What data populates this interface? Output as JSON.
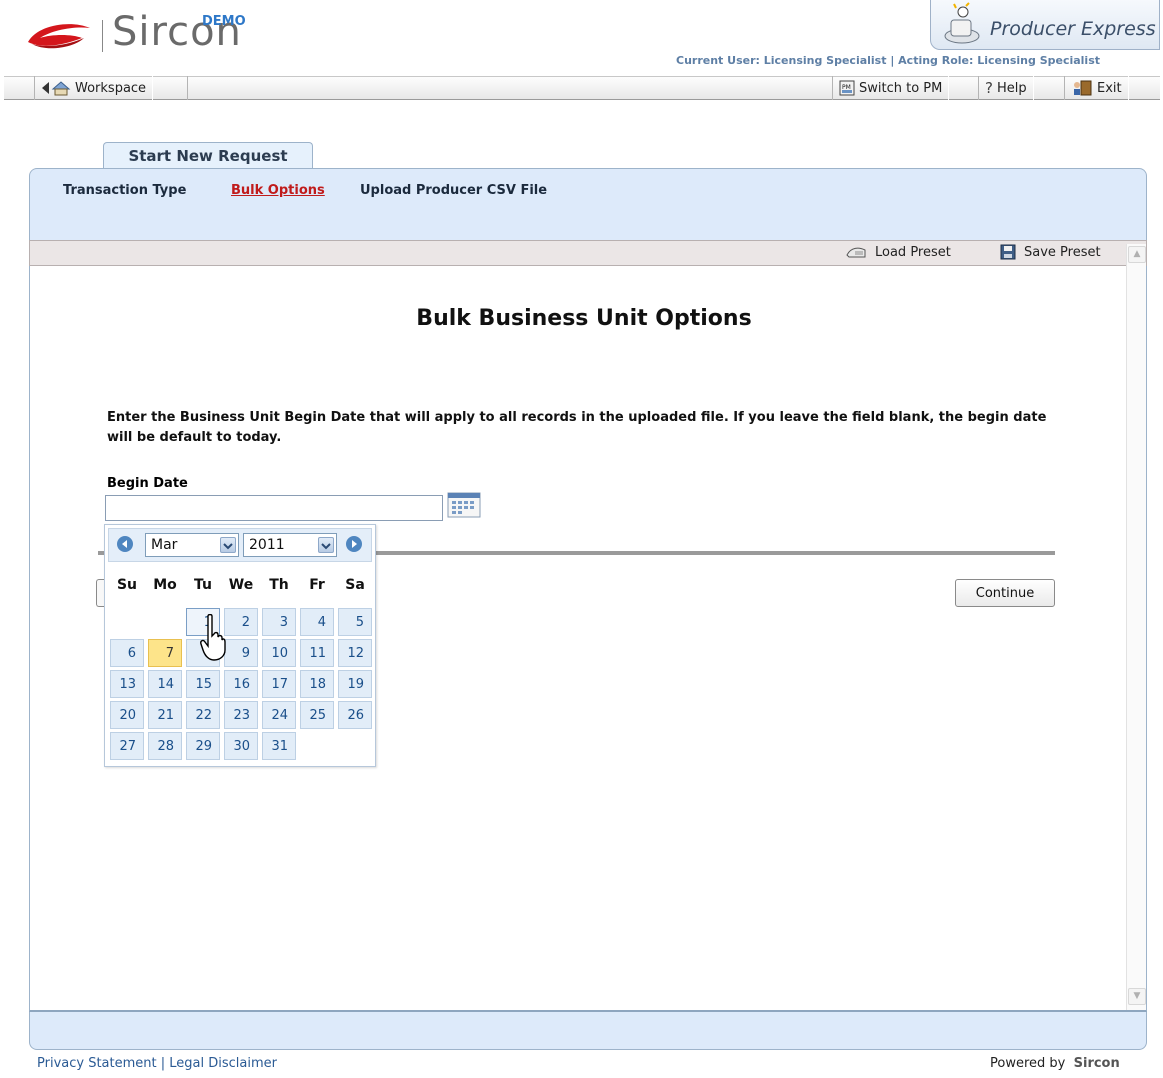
{
  "header": {
    "logo_text": "Sircon",
    "logo_badge": "DEMO",
    "product": "Producer Express",
    "user_label": "Current User: Licensing Specialist | Acting Role: Licensing Specialist"
  },
  "toolbar": {
    "workspace": "Workspace",
    "switch_pm": "Switch to PM",
    "help": "Help",
    "exit": "Exit"
  },
  "request_tab": "Start New Request",
  "steps": [
    {
      "label": "Transaction Type",
      "active": false
    },
    {
      "label": "Bulk Options",
      "active": true
    },
    {
      "label": "Upload Producer CSV File",
      "active": false
    }
  ],
  "presets": {
    "load": "Load Preset",
    "save": "Save Preset"
  },
  "main": {
    "title": "Bulk Business Unit Options",
    "instructions": "Enter the Business Unit Begin Date that will apply to all records in the uploaded file. If you leave the field blank, the begin date will be default to today.",
    "begin_date_label": "Begin Date",
    "begin_date_value": "",
    "continue_label": "Continue"
  },
  "calendar": {
    "month": "Mar",
    "year": "2011",
    "weekdays": [
      "Su",
      "Mo",
      "Tu",
      "We",
      "Th",
      "Fr",
      "Sa"
    ],
    "first_weekday_index": 2,
    "days_in_month": 31,
    "today": 7,
    "hovered": 1
  },
  "footer": {
    "privacy": "Privacy Statement",
    "separator": " | ",
    "legal": "Legal Disclaimer",
    "powered_by": "Powered by",
    "powered_brand": "Sircon"
  },
  "colors": {
    "accent_blue": "#2e78c8",
    "active_step": "#c01b1b",
    "panel_bg": "#ddeafa",
    "today_highlight": "#fde48a"
  }
}
